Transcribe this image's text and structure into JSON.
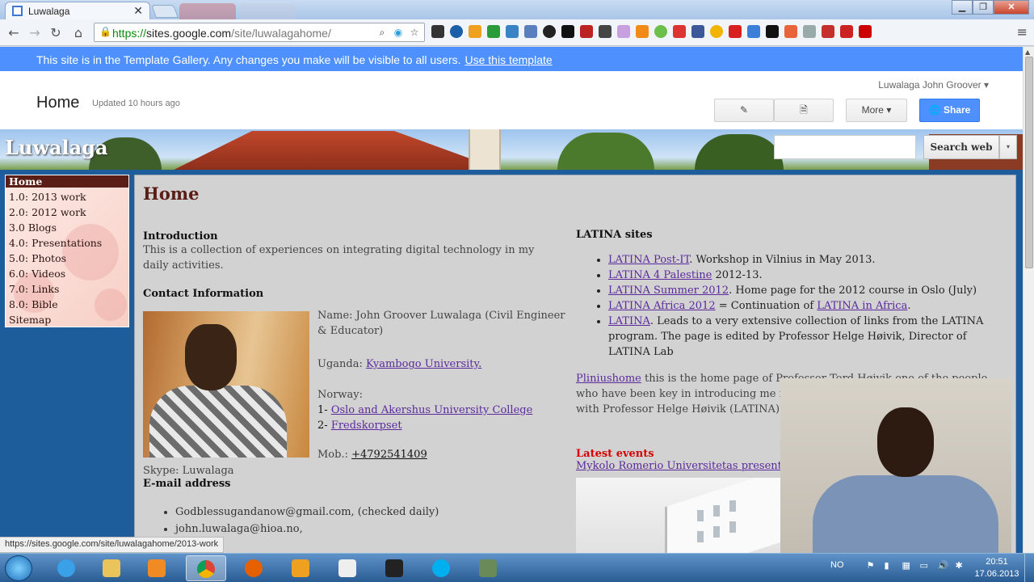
{
  "browser": {
    "tab_title": "Luwalaga",
    "tab_close": "✕",
    "url_https": "https://",
    "url_domain": "sites.google.com",
    "url_path": "/site/luwalagahome/",
    "window_minimize": "▁",
    "window_maximize": "❐",
    "window_close": "✕"
  },
  "banner": {
    "text": "This site is in the Template Gallery. Any changes you make will be visible to all users.",
    "link": "Use this template"
  },
  "sites_header": {
    "user": "Luwalaga John Groover ▾",
    "page_title": "Home",
    "updated": "Updated 10 hours ago",
    "more_label": "More ▾",
    "share_label": "Share"
  },
  "site": {
    "title": "Luwalaga",
    "search_button": "Search web",
    "search_dropdown": "▾"
  },
  "sidebar": {
    "items": [
      {
        "label": "Home"
      },
      {
        "label": "1.0: 2013 work"
      },
      {
        "label": "2.0: 2012 work"
      },
      {
        "label": "3.0 Blogs"
      },
      {
        "label": "4.0: Presentations"
      },
      {
        "label": "5.0: Photos"
      },
      {
        "label": "6.0: Videos"
      },
      {
        "label": "7.0: Links"
      },
      {
        "label": "8.0: Bible"
      },
      {
        "label": "Sitemap"
      }
    ]
  },
  "content": {
    "heading": "Home",
    "intro_heading": "Introduction",
    "intro_text": "This is a collection of experiences on integrating digital technology in my daily activities.",
    "contact_heading": "Contact Information",
    "name_line": "Name: John Groover Luwalaga (Civil Engineer & Educator)",
    "uganda_label": "Uganda:",
    "uganda_link": "Kyambogo University.",
    "norway_label": "Norway:",
    "norway_1_prefix": "1-",
    "norway_1_link": "Oslo and Akershus University College",
    "norway_2_prefix": "2-",
    "norway_2_link": "Fredskorpset",
    "mob_label": "Mob.:",
    "mob_link": "+4792541409",
    "skype": "Skype: Luwalaga",
    "email_heading": "E-mail address",
    "emails": [
      "Godblessugandanow@gmail.com, (checked daily)",
      "john.luwalaga@hioa.no,"
    ],
    "latina_heading": "LATINA sites",
    "latina_items": [
      {
        "link": "LATINA Post-IT",
        "text": ". Workshop in Vilnius in May 2013."
      },
      {
        "link": "LATINA 4 Palestine",
        "text": " 2012-13."
      },
      {
        "link": "LATINA Summer 2012",
        "text": ". Home page for the 2012 course in Oslo (July)"
      },
      {
        "link": "LATINA Africa 2012",
        "text": " = Continuation of ",
        "link2": "LATINA in Africa",
        "text2": "."
      },
      {
        "link": "LATINA",
        "text": ". Leads to a very extensive collection of links from the LATINA program. The page is edited by Professor Helge Høivik, Director of LATINA Lab"
      }
    ],
    "plinius_link": "Pliniushome",
    "plinius_text": " this is the home page of Professor Tord Høivik one of the people who have been key in introducing me in the digital technology era together with Professor Helge Høivik (LATINA).",
    "latest_heading": "Latest events",
    "latest_link": "Mykolo Romerio Universitetas presentation (May 2013)"
  },
  "status_bar": {
    "url": "https://sites.google.com/site/luwalagahome/2013-work"
  },
  "taskbar": {
    "tray_lang": "NO",
    "time": "20:51",
    "date": "17.06.2013"
  },
  "colors": {
    "banner_blue": "#4d90fe",
    "nav_active": "#5a1e16",
    "link_purple": "#5b2a9c",
    "latest_red": "#d60000",
    "page_bg": "#1d5d9b"
  }
}
